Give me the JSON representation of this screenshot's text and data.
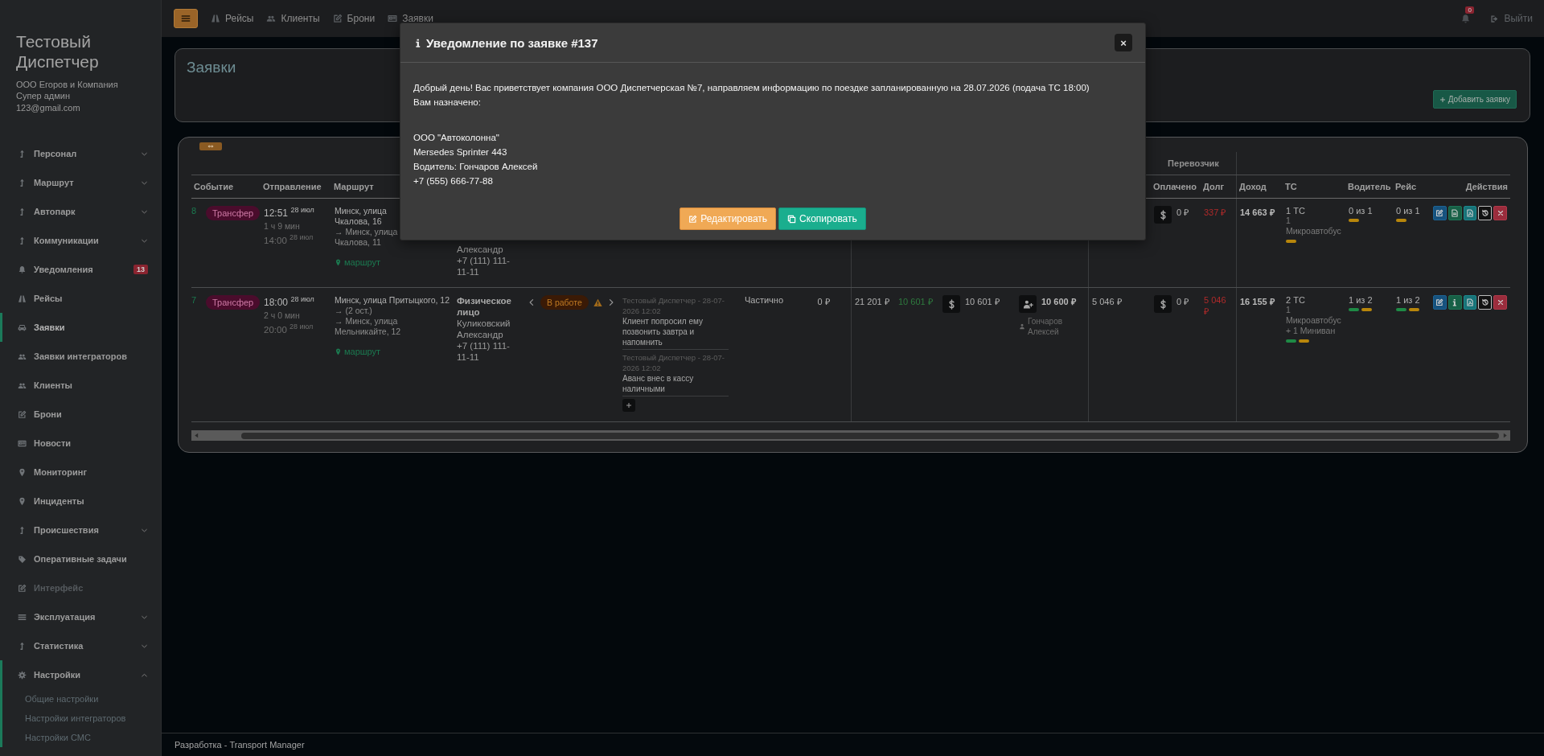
{
  "sidebar": {
    "title": "Тестовый Диспетчер",
    "info": [
      "ООО Егоров и Компания",
      "Супер админ",
      "123@gmail.com"
    ],
    "items": [
      {
        "label": "Персонал",
        "selected": false,
        "disabled": false,
        "expandable": true,
        "expanded": false
      },
      {
        "label": "Маршрут",
        "selected": false,
        "disabled": false,
        "expandable": true,
        "expanded": false
      },
      {
        "label": "Автопарк",
        "selected": false,
        "disabled": false,
        "expandable": true,
        "expanded": false
      },
      {
        "label": "Коммуникации",
        "selected": false,
        "disabled": false,
        "expandable": true,
        "expanded": false
      },
      {
        "label": "Уведомления",
        "selected": false,
        "disabled": false,
        "expandable": false,
        "badge": "13"
      },
      {
        "label": "Рейсы",
        "selected": false,
        "disabled": false,
        "expandable": false
      },
      {
        "label": "Заявки",
        "selected": true,
        "disabled": false,
        "expandable": false
      },
      {
        "label": "Заявки интеграторов",
        "selected": false,
        "disabled": false,
        "expandable": false
      },
      {
        "label": "Клиенты",
        "selected": false,
        "disabled": false,
        "expandable": false
      },
      {
        "label": "Брони",
        "selected": false,
        "disabled": false,
        "expandable": false
      },
      {
        "label": "Новости",
        "selected": false,
        "disabled": false,
        "expandable": false
      },
      {
        "label": "Мониторинг",
        "selected": false,
        "disabled": false,
        "expandable": false
      },
      {
        "label": "Инциденты",
        "selected": false,
        "disabled": false,
        "expandable": false
      },
      {
        "label": "Происшествия",
        "selected": false,
        "disabled": false,
        "expandable": true,
        "expanded": false
      },
      {
        "label": "Оперативные задачи",
        "selected": false,
        "disabled": false,
        "expandable": false
      },
      {
        "label": "Интерфейс",
        "selected": false,
        "disabled": true,
        "expandable": false
      },
      {
        "label": "Эксплуатация",
        "selected": false,
        "disabled": false,
        "expandable": true,
        "expanded": false
      },
      {
        "label": "Статистика",
        "selected": false,
        "disabled": false,
        "expandable": true,
        "expanded": false
      },
      {
        "label": "Настройки",
        "selected": false,
        "disabled": false,
        "expandable": true,
        "expanded": true,
        "children": [
          {
            "label": "Общие настройки"
          },
          {
            "label": "Настройки интеграторов"
          },
          {
            "label": "Настройки СМС"
          }
        ]
      }
    ]
  },
  "topbar": {
    "nav": [
      {
        "label": "Рейсы"
      },
      {
        "label": "Клиенты"
      },
      {
        "label": "Брони"
      },
      {
        "label": "Заявки"
      }
    ],
    "notifications_badge": "0",
    "logout": "Выйти"
  },
  "page": {
    "title": "Заявки",
    "add_button": "Добавить заявку"
  },
  "table": {
    "group_header": "Перевозчик",
    "columns_left": [
      "Событие",
      "Отправление",
      "Маршрут"
    ],
    "columns_right": [
      "Оплачено",
      "Долг",
      "Доход",
      "ТС",
      "Водитель",
      "Рейс",
      "Действия"
    ],
    "rows": [
      {
        "number": "8",
        "event": "Трансфер",
        "departure": {
          "time": "12:51",
          "date": "28 июл"
        },
        "duration": "1 ч 9 мин",
        "arrival": {
          "time": "14:00",
          "date": "28 июл"
        },
        "route": [
          "Минск, улица Чкалова, 16",
          "→ Минск, улица Чкалова, 11"
        ],
        "route_link": "маршрут",
        "client": {
          "lines": [
            "Александр",
            "+7 (111) 111-11-11"
          ]
        },
        "carrier_paid": "0 ₽",
        "carrier_debt": "337 ₽",
        "income": "14 663 ₽",
        "vehicles": "1 ТС",
        "vehicle_types": "1 Микроавтобус",
        "vehicle_bars": [
          {
            "color": "#b8860b"
          }
        ],
        "drivers": "0 из 1",
        "driver_bars": [
          {
            "color": "#b8860b"
          }
        ],
        "trips": "0 из 1",
        "trip_bars": [
          {
            "color": "#b8860b"
          }
        ],
        "actions": [
          {
            "kind": "edit"
          },
          {
            "kind": "document"
          },
          {
            "kind": "pdf"
          },
          {
            "kind": "history"
          },
          {
            "kind": "delete"
          }
        ]
      },
      {
        "number": "7",
        "event": "Трансфер",
        "departure": {
          "time": "18:00",
          "date": "28 июл"
        },
        "duration": "2 ч 0 мин",
        "arrival": {
          "time": "20:00",
          "date": "28 июл"
        },
        "route": [
          "Минск, улица Притыцкого, 12",
          "→ (2 ост.)",
          "→ Минск, улица Мельникайте, 12"
        ],
        "route_link": "маршрут",
        "client": {
          "type": "Физическое лицо",
          "lines": [
            "Куликовский Александр",
            "+7 (111) 111-11-11"
          ]
        },
        "status": {
          "label": "В работе",
          "warning": true
        },
        "comments": [
          {
            "meta": "Тестовый Диспетчер - 28-07-2026 12:02",
            "text": "Клиент попросил ему позвонить завтра и напомнить"
          },
          {
            "meta": "Тестовый Диспетчер - 28-07-2026 12:02",
            "text": "Аванс внес в кассу наличными"
          }
        ],
        "payment": "Частично",
        "deposit": "0 ₽",
        "sum": "21 201 ₽",
        "advance": "10 601 ₽",
        "receipt": "10 601 ₽",
        "debt": "10 600 ₽",
        "debt_driver": "Гончаров Алексей",
        "carrier_sum": "5 046 ₽",
        "carrier_paid": "0 ₽",
        "carrier_debt": "5 046 ₽",
        "income": "16 155 ₽",
        "vehicles": "2 ТС",
        "vehicle_types": "1 Микроавтобус + 1 Миниван",
        "vehicle_bars": [
          {
            "color": "#1e8a45"
          },
          {
            "color": "#b8860b"
          }
        ],
        "drivers": "1 из 2",
        "driver_bars": [
          {
            "color": "#1e8a45"
          },
          {
            "color": "#b8860b"
          }
        ],
        "trips": "1 из 2",
        "trip_bars": [
          {
            "color": "#1e8a45"
          },
          {
            "color": "#b8860b"
          }
        ],
        "actions": [
          {
            "kind": "edit"
          },
          {
            "kind": "info"
          },
          {
            "kind": "pdf"
          },
          {
            "kind": "history"
          },
          {
            "kind": "delete"
          }
        ]
      }
    ]
  },
  "dialog": {
    "title": "Уведомление по заявке #137",
    "close": "×",
    "paragraphs": [
      [
        "Добрый день! Вас приветствует компания ООО Диспетчерская №7, направляем информацию по поездке запланированную на 28.07.2026 (подача ТС 18:00)",
        "Вам назначено:"
      ],
      [
        "ООО \"Автоколонна\"",
        "Mersedes Sprinter 443",
        "Водитель: Гончаров Алексей",
        "+7 (555) 666-77-88"
      ]
    ],
    "buttons": [
      {
        "kind": "edit",
        "label": "Редактировать"
      },
      {
        "kind": "copy",
        "label": "Скопировать"
      }
    ]
  },
  "footer": "Разработка - Transport Manager"
}
